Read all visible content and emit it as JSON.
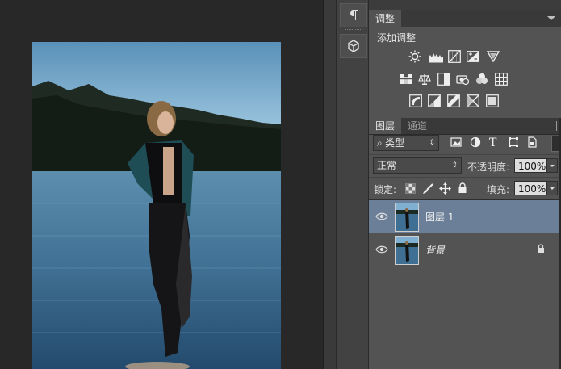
{
  "canvas": {
    "image_desc_icon": "photo"
  },
  "tool_strip": {
    "items": [
      "paragraph-icon",
      "3d-cube-icon"
    ]
  },
  "adjustments_panel": {
    "tab_label": "调整",
    "add_adjustment_label": "添加调整",
    "icons_row1": [
      "brightness-contrast-icon",
      "levels-icon",
      "curves-icon",
      "exposure-icon",
      "vibrance-icon"
    ],
    "icons_row2": [
      "hue-saturation-icon",
      "color-balance-icon",
      "black-white-icon",
      "photo-filter-icon",
      "channel-mixer-icon",
      "color-lookup-icon"
    ],
    "icons_row3": [
      "invert-icon",
      "posterize-icon",
      "threshold-icon",
      "gradient-map-icon",
      "selective-color-icon"
    ]
  },
  "layers_panel": {
    "tabs": [
      {
        "label": "图层",
        "active": true
      },
      {
        "label": "通道",
        "active": false
      }
    ],
    "filter_label": "类型",
    "blend_mode": "正常",
    "opacity_label": "不透明度:",
    "opacity_value": "100%",
    "lock_label": "锁定:",
    "fill_label": "填充:",
    "fill_value": "100%",
    "layers": [
      {
        "name": "图层 1",
        "selected": true,
        "locked": false
      },
      {
        "name": "背景",
        "selected": false,
        "locked": true
      }
    ]
  },
  "colors": {
    "selection": "#6c7f99",
    "panel_bg": "#535353",
    "canvas_bg": "#282828"
  }
}
